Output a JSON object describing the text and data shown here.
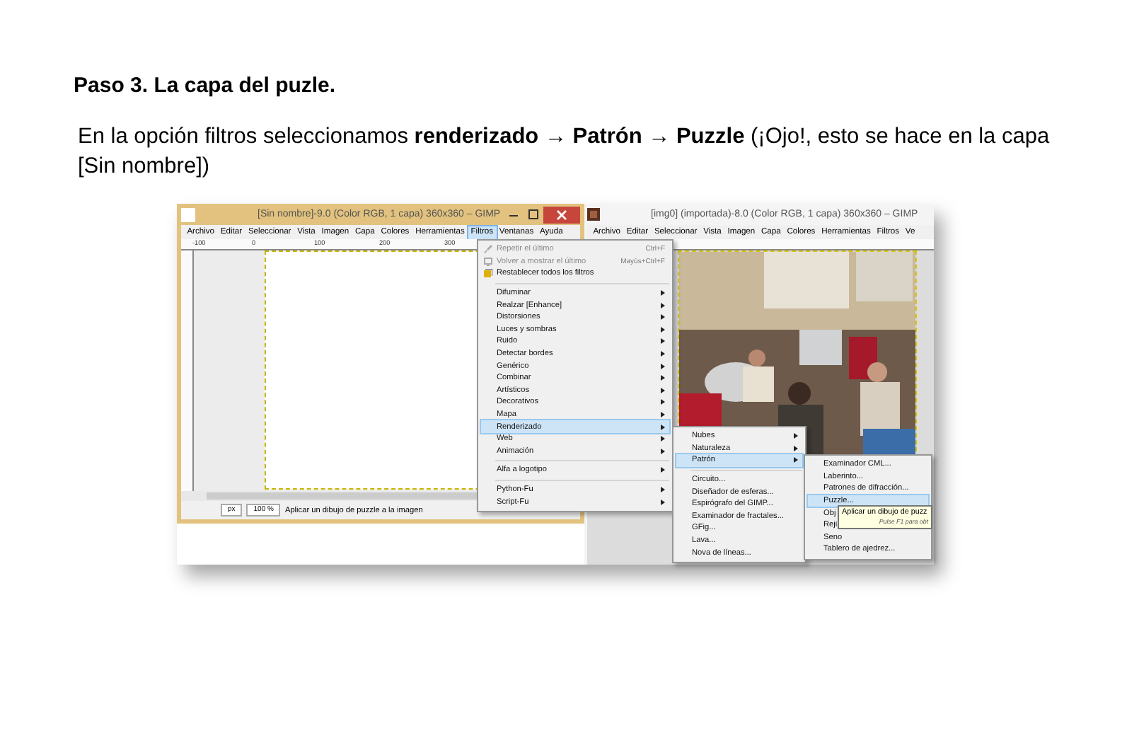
{
  "heading": "Paso 3. La capa del puzle.",
  "paragraph": "En la opción filtros seleccionamos **renderizado → Patrón → Puzzle** (¡Ojo!, esto se hace en la capa [Sin nombre])",
  "left_window": {
    "title": "[Sin nombre]-9.0 (Color RGB, 1 capa) 360x360 – GIMP",
    "menu": [
      {
        "label": "Archivo",
        "selected": false
      },
      {
        "label": "Editar",
        "selected": false
      },
      {
        "label": "Seleccionar",
        "selected": false
      },
      {
        "label": "Vista",
        "selected": false
      },
      {
        "label": "Imagen",
        "selected": false
      },
      {
        "label": "Capa",
        "selected": false
      },
      {
        "label": "Colores",
        "selected": false
      },
      {
        "label": "Herramientas",
        "selected": false
      },
      {
        "label": "Filtros",
        "selected": true
      },
      {
        "label": "Ventanas",
        "selected": false
      },
      {
        "label": "Ayuda",
        "selected": false
      }
    ],
    "ruler_labels": [
      "-100",
      "0",
      "100",
      "200",
      "300"
    ],
    "status": {
      "unit": "px",
      "zoom": "100 %",
      "message": "Aplicar un dibujo de puzzle a la imagen"
    }
  },
  "right_window": {
    "title": "[img0] (importada)-8.0 (Color RGB, 1 capa) 360x360 – GIMP",
    "menu": [
      "Archivo",
      "Editar",
      "Seleccionar",
      "Vista",
      "Imagen",
      "Capa",
      "Colores",
      "Herramientas",
      "Filtros",
      "Ve"
    ],
    "image": {
      "kind": "picture"
    }
  },
  "filters_menu": {
    "items": [
      {
        "kind": "icon_command",
        "label": "Repetir el último",
        "shortcut": "Ctrl+F",
        "disabled": true,
        "selected": false
      },
      {
        "kind": "icon_command",
        "label": "Volver a mostrar el último",
        "shortcut": "Mayús+Ctrl+F",
        "disabled": true,
        "selected": false
      },
      {
        "kind": "icon_command",
        "label": "Restablecer todos los filtros",
        "disabled": false,
        "selected": false
      },
      {
        "kind": "separator"
      },
      {
        "kind": "submenu",
        "label": "Difuminar",
        "disabled": false,
        "selected": false
      },
      {
        "kind": "submenu",
        "label": "Realzar [Enhance]",
        "disabled": false,
        "selected": false
      },
      {
        "kind": "submenu",
        "label": "Distorsiones",
        "disabled": false,
        "selected": false
      },
      {
        "kind": "submenu",
        "label": "Luces y sombras",
        "disabled": false,
        "selected": false
      },
      {
        "kind": "submenu",
        "label": "Ruido",
        "disabled": false,
        "selected": false
      },
      {
        "kind": "submenu",
        "label": "Detectar bordes",
        "disabled": false,
        "selected": false
      },
      {
        "kind": "submenu",
        "label": "Genérico",
        "disabled": false,
        "selected": false
      },
      {
        "kind": "submenu",
        "label": "Combinar",
        "disabled": false,
        "selected": false
      },
      {
        "kind": "submenu",
        "label": "Artísticos",
        "disabled": false,
        "selected": false
      },
      {
        "kind": "submenu",
        "label": "Decorativos",
        "disabled": false,
        "selected": false
      },
      {
        "kind": "submenu",
        "label": "Mapa",
        "disabled": false,
        "selected": false
      },
      {
        "kind": "submenu",
        "label": "Renderizado",
        "disabled": false,
        "selected": true
      },
      {
        "kind": "submenu",
        "label": "Web",
        "disabled": false,
        "selected": false
      },
      {
        "kind": "submenu",
        "label": "Animación",
        "disabled": false,
        "selected": false
      },
      {
        "kind": "separator"
      },
      {
        "kind": "submenu",
        "label": "Alfa a logotipo",
        "disabled": false,
        "selected": false
      },
      {
        "kind": "separator"
      },
      {
        "kind": "submenu",
        "label": "Python-Fu",
        "disabled": false,
        "selected": false
      },
      {
        "kind": "submenu",
        "label": "Script-Fu",
        "disabled": false,
        "selected": false
      }
    ]
  },
  "render_menu": {
    "items": [
      {
        "kind": "submenu",
        "label": "Nubes",
        "selected": false
      },
      {
        "kind": "submenu",
        "label": "Naturaleza",
        "selected": false
      },
      {
        "kind": "submenu",
        "label": "Patrón",
        "selected": true
      },
      {
        "kind": "separator"
      },
      {
        "kind": "command",
        "label": "Circuito...",
        "selected": false
      },
      {
        "kind": "command",
        "label": "Diseñador de esferas...",
        "selected": false
      },
      {
        "kind": "command",
        "label": "Espirógrafo del GIMP...",
        "selected": false
      },
      {
        "kind": "command",
        "label": "Examinador de fractales...",
        "selected": false
      },
      {
        "kind": "command",
        "label": "GFig...",
        "selected": false
      },
      {
        "kind": "command",
        "label": "Lava...",
        "selected": false
      },
      {
        "kind": "command",
        "label": "Nova de líneas...",
        "selected": false
      }
    ]
  },
  "pattern_menu": {
    "items": [
      {
        "kind": "command",
        "label": "Examinador CML...",
        "selected": false
      },
      {
        "kind": "command",
        "label": "Laberinto...",
        "selected": false
      },
      {
        "kind": "command",
        "label": "Patrones de difracción...",
        "selected": false
      },
      {
        "kind": "command",
        "label": "Puzzle...",
        "selected": true
      },
      {
        "kind": "command",
        "label": "Obj",
        "selected": false
      },
      {
        "kind": "command",
        "label": "Reji",
        "selected": false
      },
      {
        "kind": "command",
        "label": "Seno",
        "selected": false
      },
      {
        "kind": "command",
        "label": "Tablero de ajedrez...",
        "selected": false
      }
    ]
  },
  "tooltip": {
    "text": "Aplicar un dibujo de puzz",
    "hint": "Pulse F1 para obt"
  }
}
